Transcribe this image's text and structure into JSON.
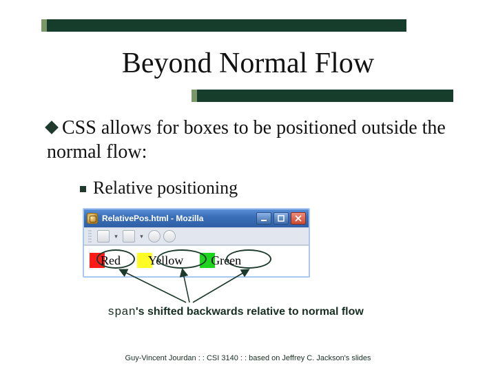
{
  "title": "Beyond Normal Flow",
  "bullet_main": "CSS allows for boxes to be positioned outside the normal flow:",
  "sub_bullet": "Relative positioning",
  "window": {
    "title": "RelativePos.html - Mozilla",
    "labels": {
      "red": "Red",
      "yellow": "Yellow",
      "green": "Green"
    }
  },
  "caption": {
    "code": "span",
    "rest": "'s shifted backwards relative to normal flow"
  },
  "footer": "Guy-Vincent Jourdan : : CSI 3140 : : based on Jeffrey C. Jackson's slides",
  "colors": {
    "accent_dark": "#163c2c"
  }
}
